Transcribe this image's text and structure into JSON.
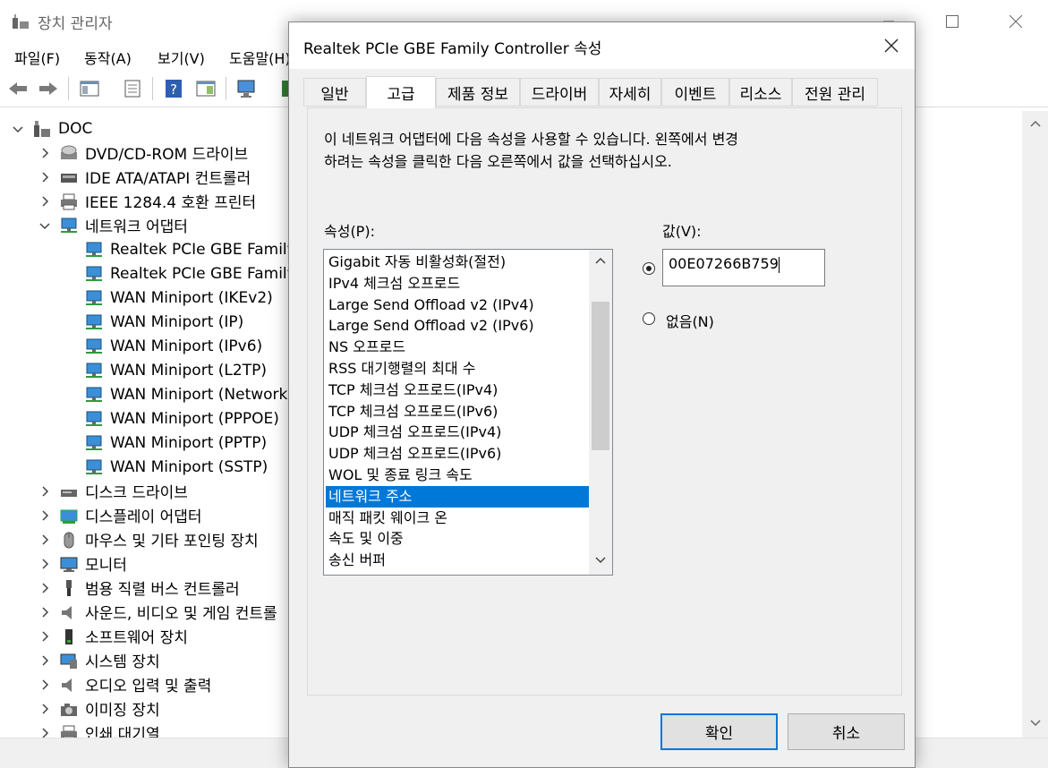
{
  "main_window": {
    "title": "장치 관리자",
    "menu": [
      "파일(F)",
      "동작(A)",
      "보기(V)",
      "도움말(H)"
    ]
  },
  "tree": {
    "root": "DOC",
    "items": [
      {
        "label": "DVD/CD-ROM 드라이브",
        "icon": "dvd-drive-icon",
        "expanded": false
      },
      {
        "label": "IDE ATA/ATAPI 컨트롤러",
        "icon": "ide-controller-icon",
        "expanded": false
      },
      {
        "label": "IEEE 1284.4 호환 프린터",
        "icon": "printer-icon",
        "expanded": false
      },
      {
        "label": "네트워크 어댑터",
        "icon": "network-adapter-icon",
        "expanded": true
      },
      {
        "label": "Realtek PCIe GBE Family C",
        "icon": "network-adapter-icon",
        "child": true
      },
      {
        "label": "Realtek PCIe GBE Family C",
        "icon": "network-adapter-icon",
        "child": true
      },
      {
        "label": "WAN Miniport (IKEv2)",
        "icon": "network-adapter-icon",
        "child": true
      },
      {
        "label": "WAN Miniport (IP)",
        "icon": "network-adapter-icon",
        "child": true
      },
      {
        "label": "WAN Miniport (IPv6)",
        "icon": "network-adapter-icon",
        "child": true
      },
      {
        "label": "WAN Miniport (L2TP)",
        "icon": "network-adapter-icon",
        "child": true
      },
      {
        "label": "WAN Miniport (Network",
        "icon": "network-adapter-icon",
        "child": true
      },
      {
        "label": "WAN Miniport (PPPOE)",
        "icon": "network-adapter-icon",
        "child": true
      },
      {
        "label": "WAN Miniport (PPTP)",
        "icon": "network-adapter-icon",
        "child": true
      },
      {
        "label": "WAN Miniport (SSTP)",
        "icon": "network-adapter-icon",
        "child": true
      },
      {
        "label": "디스크 드라이브",
        "icon": "disk-drive-icon",
        "expanded": false
      },
      {
        "label": "디스플레이 어댑터",
        "icon": "display-adapter-icon",
        "expanded": false
      },
      {
        "label": "마우스 및 기타 포인팅 장치",
        "icon": "mouse-icon",
        "expanded": false
      },
      {
        "label": "모니터",
        "icon": "monitor-icon",
        "expanded": false
      },
      {
        "label": "범용 직렬 버스 컨트롤러",
        "icon": "usb-icon",
        "expanded": false
      },
      {
        "label": "사운드, 비디오 및 게임 컨트롤",
        "icon": "speaker-icon",
        "expanded": false
      },
      {
        "label": "소프트웨어 장치",
        "icon": "software-device-icon",
        "expanded": false
      },
      {
        "label": "시스템 장치",
        "icon": "system-device-icon",
        "expanded": false
      },
      {
        "label": "오디오 입력 및 출력",
        "icon": "speaker-icon",
        "expanded": false
      },
      {
        "label": "이미징 장치",
        "icon": "camera-icon",
        "expanded": false
      },
      {
        "label": "인쇄 대기열",
        "icon": "printer-icon",
        "expanded": false
      }
    ]
  },
  "dialog": {
    "title": "Realtek PCIe GBE Family Controller 속성",
    "tabs": [
      "일반",
      "고급",
      "제품 정보",
      "드라이버",
      "자세히",
      "이벤트",
      "리소스",
      "전원 관리"
    ],
    "active_tab": "고급",
    "intro_line1": "이 네트워크 어댑터에 다음 속성을 사용할 수 있습니다. 왼쪽에서 변경",
    "intro_line2": "하려는 속성을 클릭한 다음 오른쪽에서 값을 선택하십시오.",
    "property_label": "속성(P):",
    "value_label": "값(V):",
    "properties": [
      "Gigabit 자동 비활성화(절전)",
      "IPv4 체크섬 오프로드",
      "Large Send Offload v2 (IPv4)",
      "Large Send Offload v2 (IPv6)",
      "NS 오프로드",
      "RSS 대기행렬의 최대 수",
      "TCP 체크섬 오프로드(IPv4)",
      "TCP 체크섬 오프로드(IPv6)",
      "UDP 체크섬 오프로드(IPv4)",
      "UDP 체크섬 오프로드(IPv6)",
      "WOL 및 종료 링크 속도",
      "네트워크 주소",
      "매직 패킷 웨이크 온",
      "속도 및 이중",
      "송신 버퍼"
    ],
    "selected_property": "네트워크 주소",
    "value": "00E07266B759",
    "none_label": "없음(N)",
    "value_radio_checked": true,
    "ok_label": "확인",
    "cancel_label": "취소"
  },
  "colors": {
    "selection": "#0078d7",
    "dialog_bg": "#f0f0f0"
  }
}
